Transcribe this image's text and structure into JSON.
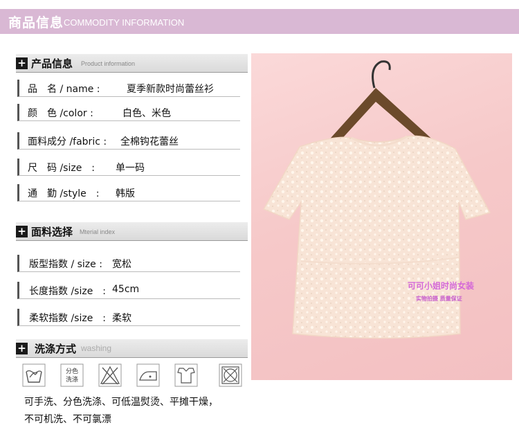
{
  "banner": {
    "title_cn": "商品信息",
    "title_en": "COMMODITY INFORMATION"
  },
  "product_info": {
    "heading_cn": "产品信息",
    "heading_en": "Product information",
    "rows": [
      {
        "label": "品　名 / name :",
        "value": "夏季新款时尚蕾丝衫"
      },
      {
        "label": "颜　色 /color :",
        "value": "白色、米色"
      },
      {
        "label": "面料成分 /fabric :",
        "value": "全棉钩花蕾丝"
      },
      {
        "label": "尺　码 /size　:",
        "value": "单一码"
      },
      {
        "label": "通　勤 /style　:",
        "value": "韩版"
      }
    ]
  },
  "material": {
    "heading_cn": "面料选择",
    "heading_en": "Mterial index",
    "rows": [
      {
        "label": "版型指数 / size :",
        "value": "宽松"
      },
      {
        "label": "长度指数 /size　:",
        "value": "45cm"
      },
      {
        "label": "柔软指数 /size　:",
        "value": "柔软"
      }
    ]
  },
  "washing": {
    "heading_cn": "洗涤方式",
    "heading_en": "washing",
    "icons": [
      "hand-wash-icon",
      "separate-wash-icon",
      "no-bleach-icon",
      "low-iron-icon",
      "flat-dry-icon",
      "no-tumble-dry-icon"
    ],
    "separate_icon_text_line1": "分色",
    "separate_icon_text_line2": "洗涤",
    "text_line1": "可手洗、分色洗涤、可低温熨烫、平摊干燥，",
    "text_line2": "不可机洗、不可氯漂"
  },
  "photo": {
    "watermark_line1": "可可小姐时尚女装",
    "watermark_line2": "实物拍摄 质量保证"
  },
  "colors": {
    "banner": "#d9b8d4",
    "watermark": "#d468d8",
    "background_pink": "#f6c9c9"
  }
}
